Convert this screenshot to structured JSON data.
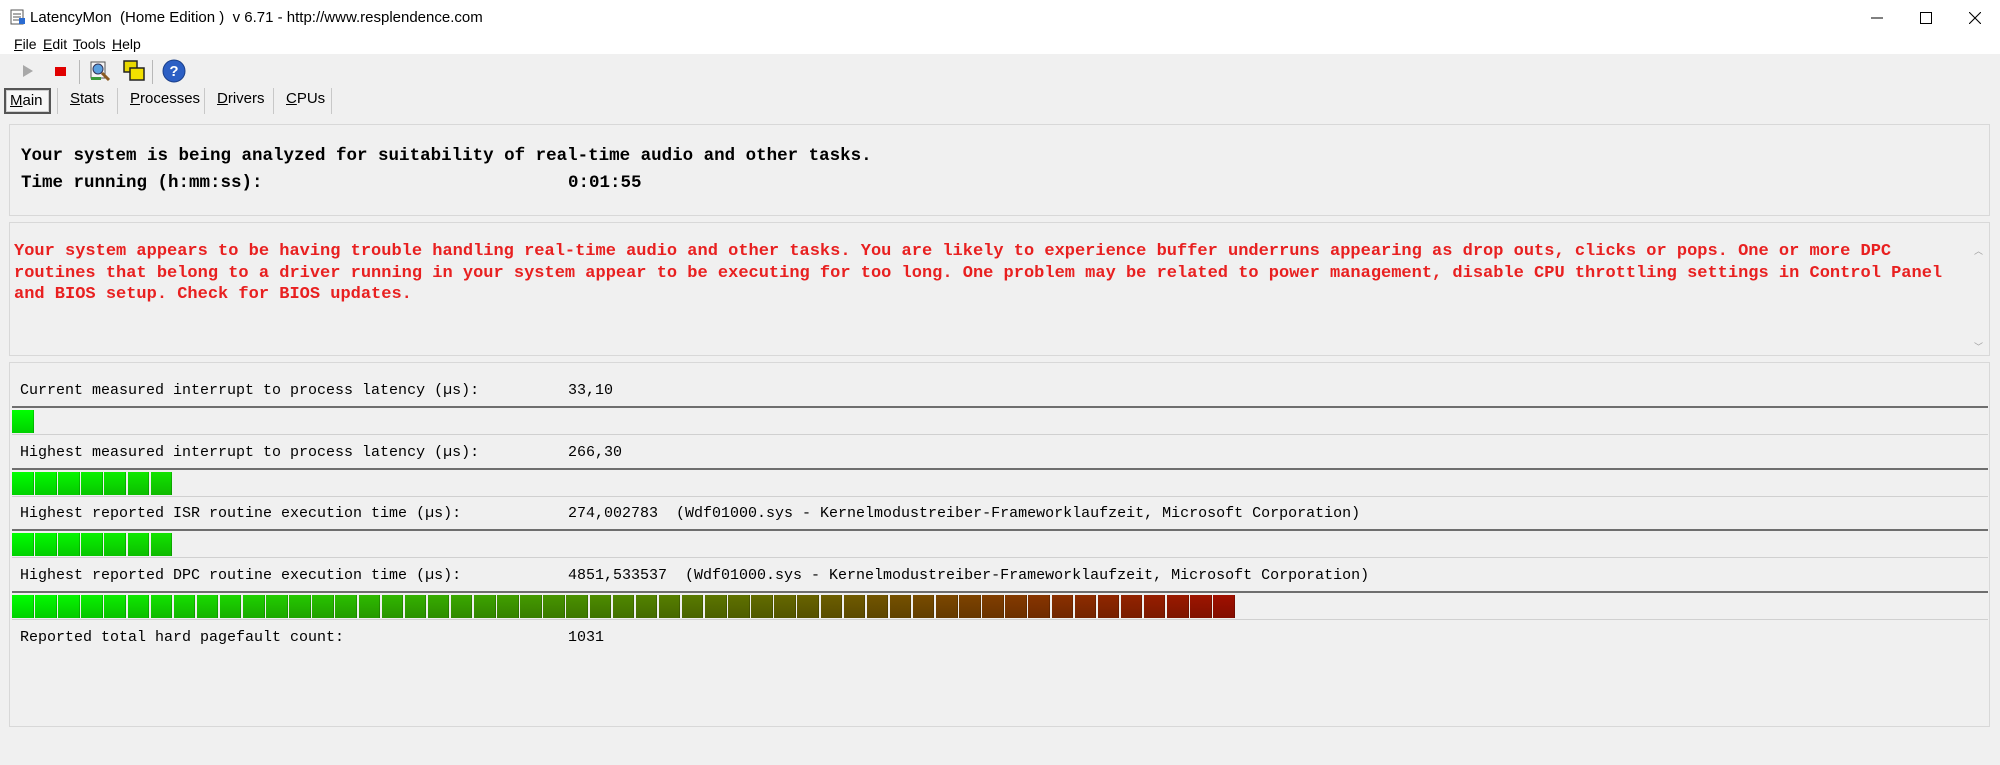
{
  "window": {
    "title": "LatencyMon  (Home Edition )  v 6.71 - http://www.resplendence.com",
    "controls": {
      "minimize": "–",
      "maximize": "□",
      "close": "✕"
    }
  },
  "menu": [
    {
      "underline": "F",
      "rest": "ile"
    },
    {
      "underline": "E",
      "rest": "dit"
    },
    {
      "underline": "T",
      "rest": "ools"
    },
    {
      "underline": "H",
      "rest": "elp"
    }
  ],
  "toolbar": {
    "icons": [
      "play-icon",
      "stop-icon",
      "analyze-icon",
      "windows-icon",
      "help-icon"
    ],
    "help_glyph": "?"
  },
  "tabs": [
    {
      "underline": "M",
      "rest": "ain",
      "active": true
    },
    {
      "underline": "S",
      "rest": "tats",
      "active": false
    },
    {
      "underline": "P",
      "rest": "rocesses",
      "active": false
    },
    {
      "underline": "D",
      "rest": "rivers",
      "active": false
    },
    {
      "underline": "C",
      "rest": "PUs",
      "active": false
    }
  ],
  "status": {
    "analyzing": "Your system is being analyzed for suitability of real-time audio and other tasks.",
    "time_label": "Time running (h:mm:ss):",
    "time_value": "0:01:55"
  },
  "verdict": "Your system appears to be having trouble handling real-time audio and other tasks. You are likely to experience buffer underruns appearing as drop outs, clicks or pops. One or more DPC routines that belong to a driver running in your system appear to be executing for too long. One problem may be related to power management, disable CPU throttling settings in Control Panel and BIOS setup. Check for BIOS updates.",
  "metrics": [
    {
      "label": "Current measured interrupt to process latency (µs):",
      "value": "33,10",
      "bar_segments": 1
    },
    {
      "label": "Highest measured interrupt to process latency (µs):",
      "value": "266,30",
      "bar_segments": 7
    },
    {
      "label": "Highest reported ISR routine execution time (µs):",
      "value": "274,002783  (Wdf01000.sys - Kernelmodustreiber-Frameworklaufzeit, Microsoft Corporation)",
      "bar_segments": 7
    },
    {
      "label": "Highest reported DPC routine execution time (µs):",
      "value": "4851,533537  (Wdf01000.sys - Kernelmodustreiber-Frameworklaufzeit, Microsoft Corporation)",
      "bar_segments": 53
    },
    {
      "label": "Reported total hard pagefault count:",
      "value": "1031"
    }
  ],
  "colors": {
    "verdict_text": "#e82020",
    "bar_low": "#00ff00",
    "bar_high": "#a01000"
  }
}
